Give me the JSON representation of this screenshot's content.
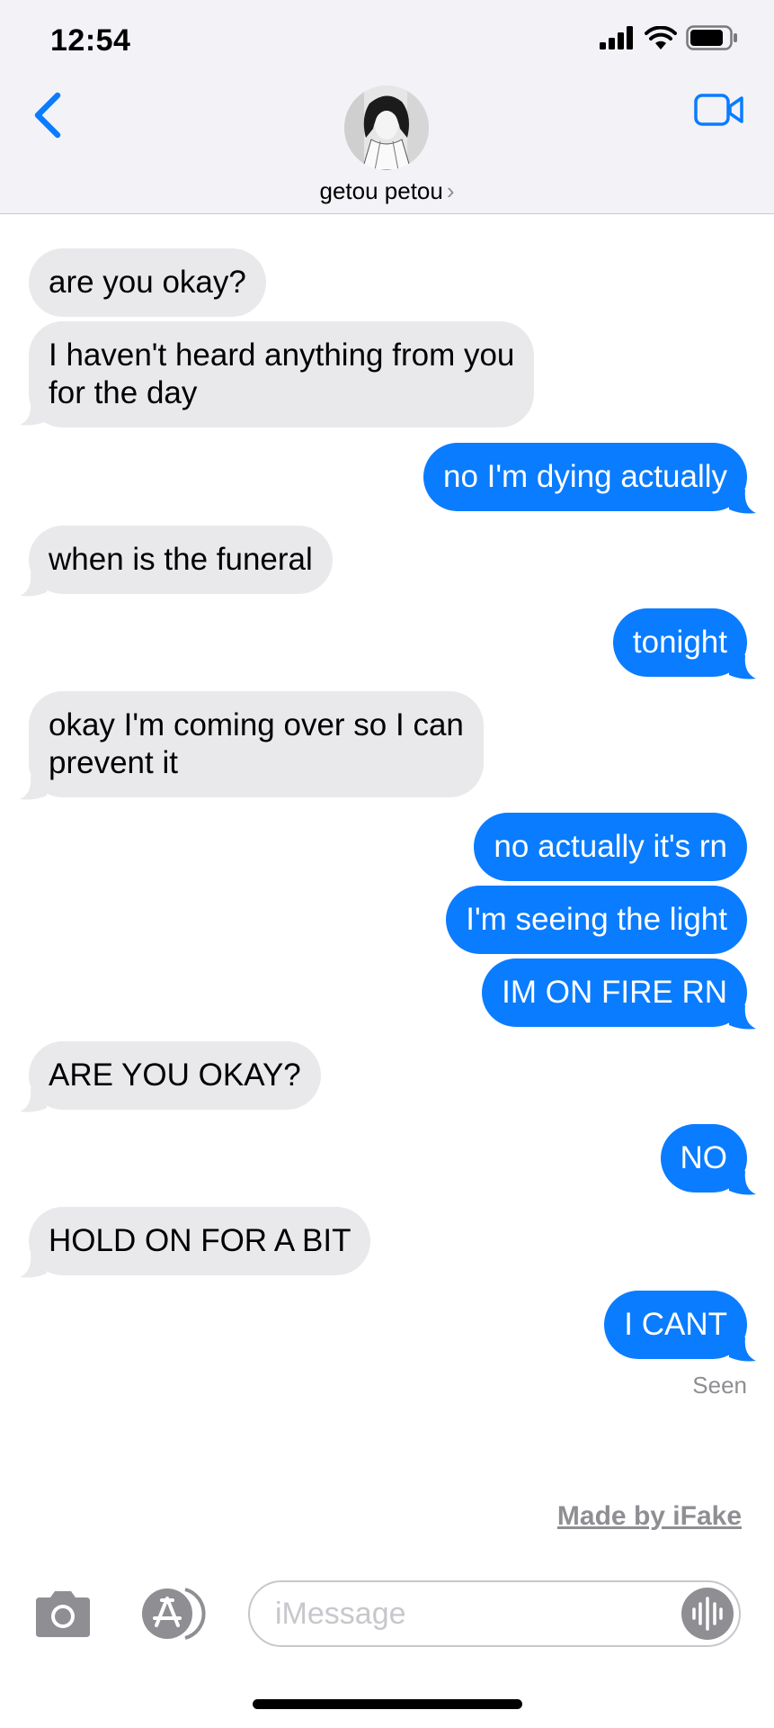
{
  "status_bar": {
    "time": "12:54"
  },
  "header": {
    "contact_name": "getou petou",
    "chevron": "›"
  },
  "icons": {
    "back": "chevron-left-icon",
    "video": "video-camera-icon",
    "signal": "cellular-signal-icon",
    "wifi": "wifi-icon",
    "battery": "battery-icon",
    "camera": "camera-icon",
    "appstore": "app-store-icon",
    "audio": "audio-waveform-icon"
  },
  "colors": {
    "outgoing": "#0a7cff",
    "incoming": "#e9e9eb",
    "accent": "#0a7cff"
  },
  "messages": [
    {
      "from": "them",
      "text": "are you okay?"
    },
    {
      "from": "them",
      "text": "I haven't heard anything from you\nfor the day"
    },
    {
      "from": "me",
      "text": "no I'm dying actually"
    },
    {
      "from": "them",
      "text": "when is the funeral"
    },
    {
      "from": "me",
      "text": "tonight"
    },
    {
      "from": "them",
      "text": "okay I'm coming over so I can\nprevent it"
    },
    {
      "from": "me",
      "text": "no actually it's rn"
    },
    {
      "from": "me",
      "text": "I'm seeing the light"
    },
    {
      "from": "me",
      "text": "IM ON FIRE RN"
    },
    {
      "from": "them",
      "text": "ARE YOU OKAY?"
    },
    {
      "from": "me",
      "text": "NO"
    },
    {
      "from": "them",
      "text": "HOLD ON FOR A BIT"
    },
    {
      "from": "me",
      "text": "I CANT"
    }
  ],
  "status": {
    "seen": "Seen"
  },
  "watermark": "Made by iFake",
  "composer": {
    "placeholder": "iMessage"
  }
}
